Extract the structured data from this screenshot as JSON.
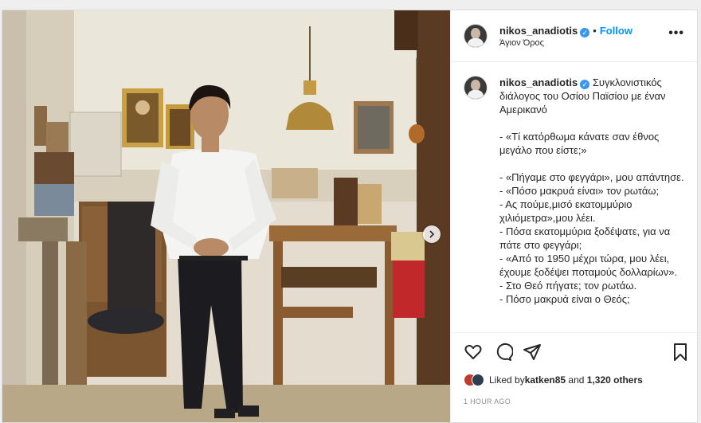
{
  "post": {
    "username": "nikos_anadiotis",
    "verified_glyph": "✓",
    "separator": "•",
    "follow_label": "Follow",
    "location": "Άγιον Όρος",
    "more_label": "•••",
    "caption": {
      "username": "nikos_anadiotis",
      "text": "Συγκλονιστικός διάλογος του Οσίου Παϊσίου με έναν Αμερικανό\n\n- «Τί κατόρθωμα κάνατε σαν έθνος μεγάλο που είστε;»\n\n- «Πήγαμε στο φεγγάρι», μου απάντησε.\n- «Πόσο μακρυά είναι» τον ρωτάω;\n- Ας πούμε,μισό εκατομμύριο χιλιόμετρα»,μου λέει.\n- Πόσα εκατομμύρια ξοδέψατε, για να πάτε στο φεγγάρι;\n- «Από το 1950 μέχρι τώρα, μου λέει, έχουμε ξοδέψει ποταμούς δολλαρίων».\n- Στο Θεό πήγατε; τον ρωτάω.\n- Πόσο μακρυά είναι ο Θεός;"
    },
    "actions": {
      "like": "heart-icon",
      "comment": "comment-icon",
      "share": "share-icon",
      "save": "bookmark-icon"
    },
    "likes": {
      "prefix": "Liked by ",
      "user": "katken85",
      "middle": " and ",
      "others": "1,320 others"
    },
    "timestamp": "1 HOUR AGO"
  },
  "colors": {
    "link": "#0095f6",
    "verified": "#3897f0",
    "text": "#262626",
    "muted": "#8e8e8e"
  }
}
